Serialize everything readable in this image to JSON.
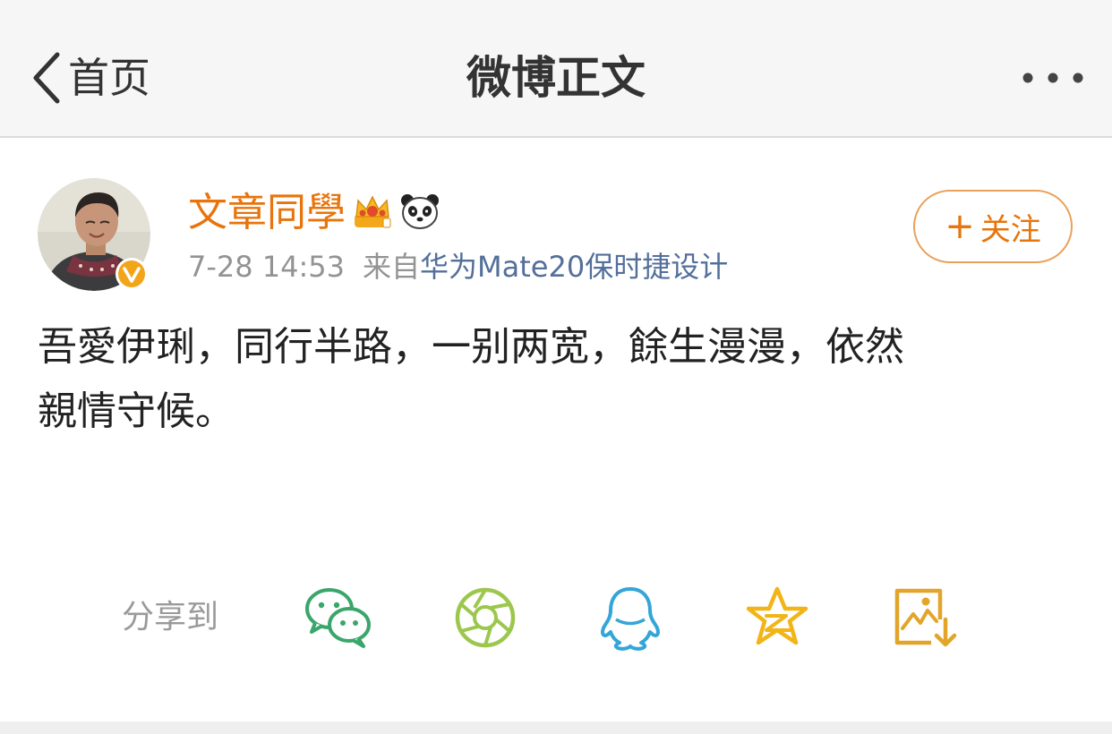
{
  "nav": {
    "back_label": "首页",
    "title": "微博正文",
    "more_icon": "more-dots-icon"
  },
  "post": {
    "username": "文章同學",
    "timestamp": "7-28 14:53",
    "source_prefix": "来自",
    "source_device": "华为Mate20保时捷设计",
    "follow_label": "关注",
    "follow_plus": "+",
    "text_line1": "吾愛伊琍，同行半路，一别两宽，餘生漫漫，依然",
    "text_line2": "親情守候。",
    "verified_icon": "verified-v-icon",
    "badges": [
      "crown-icon",
      "panda-icon"
    ]
  },
  "share": {
    "label": "分享到",
    "targets": [
      "wechat-icon",
      "moments-icon",
      "qq-icon",
      "qzone-icon",
      "save-image-icon"
    ]
  },
  "colors": {
    "accent": "#e8740b",
    "link": "#536f9a",
    "muted": "#939393",
    "navbar_bg": "#f6f6f6"
  }
}
